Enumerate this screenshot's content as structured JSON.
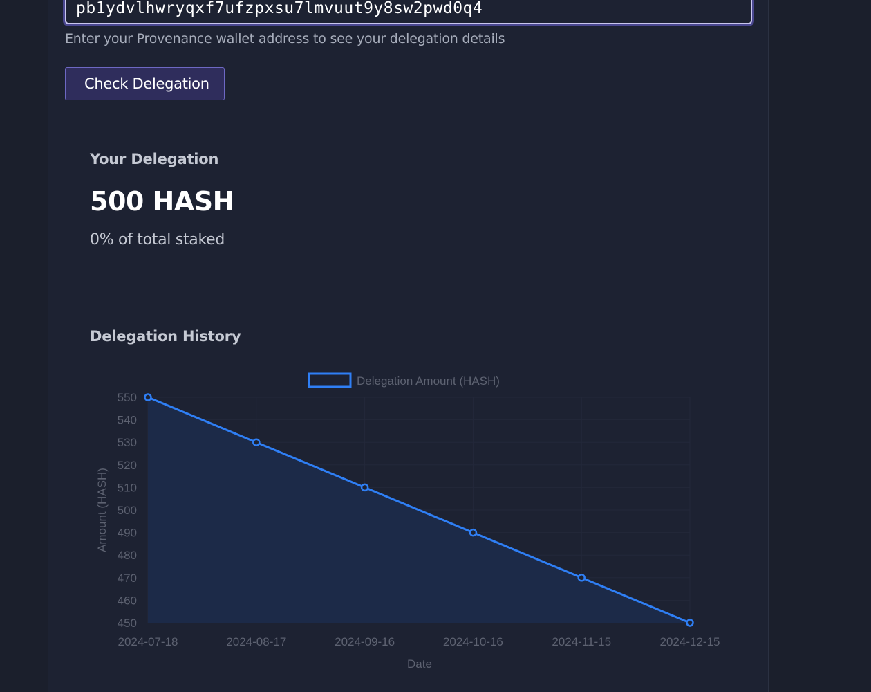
{
  "wallet": {
    "address_value": "pb1ydvlhwryqxf7ufzpxsu7lmvuut9y8sw2pwd0q4",
    "helper_text": "Enter your Provenance wallet address to see your delegation details",
    "check_button_label": "Check Delegation"
  },
  "delegation": {
    "title": "Your Delegation",
    "amount": "500 HASH",
    "percent_text": "0% of total staked"
  },
  "history": {
    "title": "Delegation History"
  },
  "colors": {
    "accent": "#6d68c3",
    "line": "#2f7ff5"
  },
  "chart_data": {
    "type": "line",
    "title": "",
    "xlabel": "Date",
    "ylabel": "Amount (HASH)",
    "x": [
      "2024-07-18",
      "2024-08-17",
      "2024-09-16",
      "2024-10-16",
      "2024-11-15",
      "2024-12-15"
    ],
    "series": [
      {
        "name": "Delegation Amount (HASH)",
        "values": [
          550,
          530,
          510,
          490,
          470,
          450
        ]
      }
    ],
    "ylim": [
      450,
      550
    ],
    "yticks": [
      550,
      540,
      530,
      520,
      510,
      500,
      490,
      480,
      470,
      460,
      450
    ],
    "fill": true,
    "grid": true,
    "legend": "top"
  }
}
